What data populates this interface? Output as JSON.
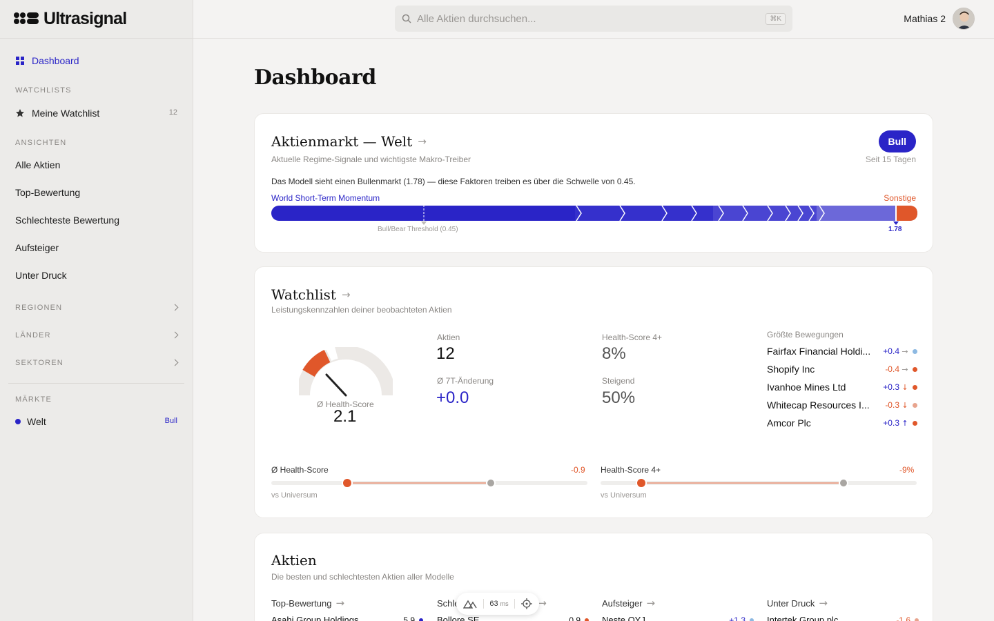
{
  "app": {
    "name": "Ultrasignal"
  },
  "search": {
    "placeholder": "Alle Aktien durchsuchen...",
    "shortcut": "⌘K"
  },
  "user": {
    "name": "Mathias 2"
  },
  "sidebar": {
    "dashboard": "Dashboard",
    "sections": {
      "watchlists": "WATCHLISTS",
      "views": "ANSICHTEN",
      "regions": "REGIONEN",
      "countries": "LÄNDER",
      "sectors": "SEKTOREN",
      "markets": "MÄRKTE"
    },
    "watchlist": {
      "label": "Meine Watchlist",
      "count": "12"
    },
    "views": [
      "Alle Aktien",
      "Top-Bewertung",
      "Schlechteste Bewertung",
      "Aufsteiger",
      "Unter Druck"
    ],
    "market": {
      "label": "Welt",
      "regime": "Bull",
      "dot_color": "#2a24c7"
    }
  },
  "page": {
    "title": "Dashboard"
  },
  "market_card": {
    "title": "Aktienmarkt — Welt",
    "subtitle": "Aktuelle Regime-Signale und wichtigste Makro-Treiber",
    "badge": "Bull",
    "since": "Seit 15 Tagen",
    "description": "Das Modell sieht einen Bullenmarkt (1.78) — diese Faktoren treiben es über die Schwelle von 0.45.",
    "left_factor": "World Short-Term Momentum",
    "right_factor": "Sonstige",
    "threshold_label": "Bull/Bear Threshold (0.45)",
    "score": "1.78",
    "colors": {
      "bull": "#2a24c7",
      "other": "#e0572a"
    }
  },
  "watchlist_card": {
    "title": "Watchlist",
    "subtitle": "Leistungskennzahlen deiner beobachteten Aktien",
    "gauge": {
      "label": "Ø Health-Score",
      "value": "2.1"
    },
    "stats": {
      "stocks_label": "Aktien",
      "stocks_value": "12",
      "health4_label": "Health-Score 4+",
      "health4_value": "8%",
      "change_label": "Ø 7T-Änderung",
      "change_value": "+0.0",
      "rising_label": "Steigend",
      "rising_value": "50%"
    },
    "moves_title": "Größte Bewegungen",
    "moves": [
      {
        "name": "Fairfax Financial Holdi...",
        "delta": "+0.4",
        "dir": "pos",
        "arrow": "→",
        "dot": "#8db9e2"
      },
      {
        "name": "Shopify Inc",
        "delta": "-0.4",
        "dir": "neg",
        "arrow": "→",
        "dot": "#e0572a"
      },
      {
        "name": "Ivanhoe Mines Ltd",
        "delta": "+0.3",
        "dir": "pos",
        "arrow": "↓",
        "dot": "#e0572a"
      },
      {
        "name": "Whitecap Resources I...",
        "delta": "-0.3",
        "dir": "neg",
        "arrow": "↓",
        "dot": "#e8a48e"
      },
      {
        "name": "Amcor Plc",
        "delta": "+0.3",
        "dir": "pos",
        "arrow": "↑",
        "dot": "#e0572a"
      }
    ],
    "sliders": [
      {
        "label": "Ø Health-Score",
        "delta": "-0.9",
        "sub": "vs Universum"
      },
      {
        "label": "Health-Score 4+",
        "delta": "-9%",
        "sub": "vs Universum"
      }
    ]
  },
  "stocks_card": {
    "title": "Aktien",
    "subtitle": "Die besten und schlechtesten Aktien aller Modelle",
    "columns": [
      {
        "head": "Top-Bewertung",
        "row_name": "Asahi Group Holdings",
        "row_value": "5.9",
        "dot": "#2a24c7"
      },
      {
        "head": "Schlechteste Bewertung",
        "row_name": "Bollore SE",
        "row_value": "0.9",
        "dot": "#e0572a"
      },
      {
        "head": "Aufsteiger",
        "row_name": "Neste OYJ",
        "row_value": "+1.3",
        "dot": "#8db9e2"
      },
      {
        "head": "Unter Druck",
        "row_name": "Intertek Group plc",
        "row_value": "-1.6",
        "dot": "#e8a48e"
      }
    ]
  },
  "perf": {
    "value": "63",
    "unit": "ms"
  }
}
